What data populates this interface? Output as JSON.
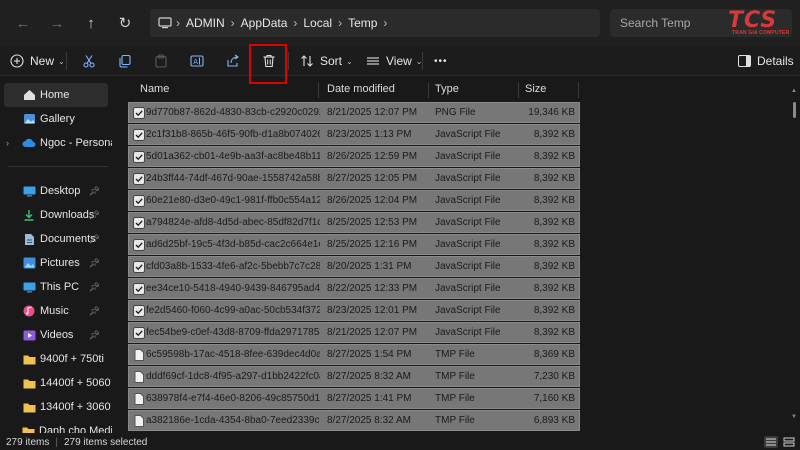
{
  "address": {
    "crumbs": [
      "ADMIN",
      "AppData",
      "Local",
      "Temp"
    ],
    "search_placeholder": "Search Temp"
  },
  "logo": {
    "text": "TCS",
    "subtext": "TRAN GIA COMPUTER"
  },
  "toolbar": {
    "new_label": "New",
    "sort_label": "Sort",
    "view_label": "View",
    "more_label": "•••",
    "details_label": "Details"
  },
  "sidebar": {
    "items": [
      {
        "label": "Home",
        "icon": "home-icon"
      },
      {
        "label": "Gallery",
        "icon": "gallery-icon"
      },
      {
        "label": "Ngoc - Personal",
        "icon": "cloud-icon"
      },
      {
        "label": "Desktop",
        "icon": "desktop-icon"
      },
      {
        "label": "Downloads",
        "icon": "download-icon"
      },
      {
        "label": "Documents",
        "icon": "documents-icon"
      },
      {
        "label": "Pictures",
        "icon": "pictures-icon"
      },
      {
        "label": "This PC",
        "icon": "pc-icon"
      },
      {
        "label": "Music",
        "icon": "music-icon"
      },
      {
        "label": "Videos",
        "icon": "videos-icon"
      },
      {
        "label": "9400f + 750ti",
        "icon": "folder-icon"
      },
      {
        "label": "14400f + 5060",
        "icon": "folder-icon"
      },
      {
        "label": "13400f + 3060",
        "icon": "folder-icon"
      },
      {
        "label": "Danh cho Media",
        "icon": "folder-icon"
      }
    ]
  },
  "columns": {
    "name": "Name",
    "date": "Date modified",
    "type": "Type",
    "size": "Size"
  },
  "files": [
    {
      "name": "9d770b87-862d-4830-83cb-c2920c0292...",
      "date": "8/21/2025 12:07 PM",
      "type": "PNG File",
      "size": "19,346 KB",
      "icon": "png"
    },
    {
      "name": "2c1f31b8-865b-46f5-90fb-d1a8b074026...",
      "date": "8/23/2025 1:13 PM",
      "type": "JavaScript File",
      "size": "8,392 KB",
      "icon": "js"
    },
    {
      "name": "5d01a362-cb01-4e9b-aa3f-ac8be48b113...",
      "date": "8/26/2025 12:59 PM",
      "type": "JavaScript File",
      "size": "8,392 KB",
      "icon": "js"
    },
    {
      "name": "24b3ff44-74df-467d-90ae-1558742a58b...",
      "date": "8/27/2025 12:05 PM",
      "type": "JavaScript File",
      "size": "8,392 KB",
      "icon": "js"
    },
    {
      "name": "60e21e80-d3e0-49c1-981f-ffb0c554a12f...",
      "date": "8/26/2025 12:04 PM",
      "type": "JavaScript File",
      "size": "8,392 KB",
      "icon": "js"
    },
    {
      "name": "a794824e-afd8-4d5d-abec-85df82d7f1d...",
      "date": "8/25/2025 12:53 PM",
      "type": "JavaScript File",
      "size": "8,392 KB",
      "icon": "js"
    },
    {
      "name": "ad6d25bf-19c5-4f3d-b85d-cac2c664e1e...",
      "date": "8/25/2025 12:16 PM",
      "type": "JavaScript File",
      "size": "8,392 KB",
      "icon": "js"
    },
    {
      "name": "cfd03a8b-1533-4fe6-af2c-5bebb7c7c284...",
      "date": "8/20/2025 1:31 PM",
      "type": "JavaScript File",
      "size": "8,392 KB",
      "icon": "js"
    },
    {
      "name": "ee34ce10-5418-4940-9439-846795ad4c4...",
      "date": "8/22/2025 12:33 PM",
      "type": "JavaScript File",
      "size": "8,392 KB",
      "icon": "js"
    },
    {
      "name": "fe2d5460-f060-4c99-a0ac-50cb534f3722...",
      "date": "8/23/2025 12:01 PM",
      "type": "JavaScript File",
      "size": "8,392 KB",
      "icon": "js"
    },
    {
      "name": "fec54be9-c0ef-43d8-8709-ffda2971785a...",
      "date": "8/21/2025 12:07 PM",
      "type": "JavaScript File",
      "size": "8,392 KB",
      "icon": "js"
    },
    {
      "name": "6c59598b-17ac-4518-8fee-639dec4d0a2...",
      "date": "8/27/2025 1:54 PM",
      "type": "TMP File",
      "size": "8,369 KB",
      "icon": "tmp"
    },
    {
      "name": "dddf69cf-1dc8-4f95-a297-d1bb2422fc0a...",
      "date": "8/27/2025 8:32 AM",
      "type": "TMP File",
      "size": "7,230 KB",
      "icon": "tmp"
    },
    {
      "name": "638978f4-e7f4-46e0-8206-49c85750d12...",
      "date": "8/27/2025 1:41 PM",
      "type": "TMP File",
      "size": "7,160 KB",
      "icon": "tmp"
    },
    {
      "name": "a382186e-1cda-4354-8ba0-7eed2339c3f...",
      "date": "8/27/2025 8:32 AM",
      "type": "TMP File",
      "size": "6,893 KB",
      "icon": "tmp"
    }
  ],
  "status": {
    "items": "279 items",
    "selected": "279 items selected"
  },
  "colors": {
    "selection": "#777777",
    "highlight": "#e00000",
    "folder": "#f0c050",
    "accent": "#4cc2ff"
  }
}
